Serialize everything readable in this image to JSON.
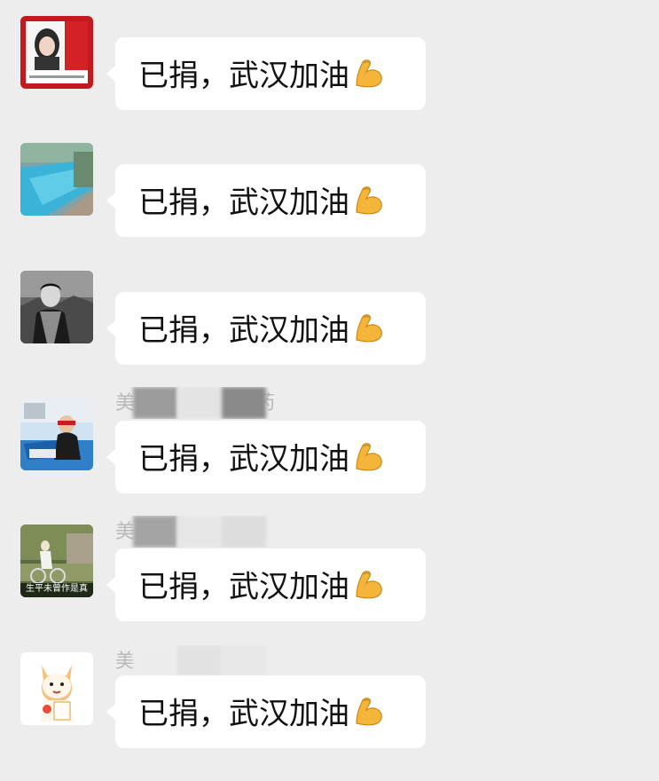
{
  "colors": {
    "background": "#ededed",
    "bubble": "#ffffff",
    "text": "#111111",
    "sender_text": "#b9b9b9",
    "emoji": "#f4b53a"
  },
  "messages": [
    {
      "avatar_icon": "avatar-red-frame-girl-icon",
      "sender": "",
      "text": "已捐，武汉加油",
      "emoji_icon": "flexed-biceps-icon"
    },
    {
      "avatar_icon": "avatar-swimming-pool-icon",
      "sender": "",
      "text": "已捐，武汉加油",
      "emoji_icon": "flexed-biceps-icon"
    },
    {
      "avatar_icon": "avatar-bw-portrait-icon",
      "sender": "",
      "text": "已捐，武汉加油",
      "emoji_icon": "flexed-biceps-icon"
    },
    {
      "avatar_icon": "avatar-boat-man-icon",
      "sender": "美",
      "sender_tail": "药",
      "text": "已捐，武汉加油",
      "emoji_icon": "flexed-biceps-icon"
    },
    {
      "avatar_icon": "avatar-cyclist-icon",
      "sender": "美",
      "sender_tail": "",
      "text": "已捐，武汉加油",
      "emoji_icon": "flexed-biceps-icon",
      "avatar_caption": "生平未曾作是真"
    },
    {
      "avatar_icon": "avatar-lucky-cat-icon",
      "sender": "美",
      "sender_tail": "",
      "text": "已捐，武汉加油",
      "emoji_icon": "flexed-biceps-icon"
    }
  ]
}
